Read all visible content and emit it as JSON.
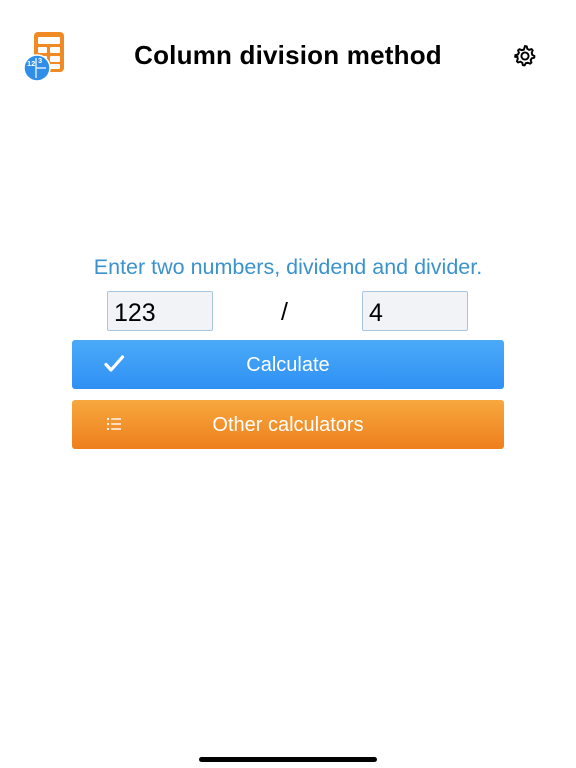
{
  "header": {
    "title": "Column division method",
    "logo_icon": "calculator-logo-icon",
    "logo_digits": "123",
    "settings_icon": "gear-icon"
  },
  "form": {
    "instruction": "Enter two numbers, dividend and divider.",
    "dividend_value": "123",
    "divider_value": "4",
    "operator": "/"
  },
  "buttons": {
    "calculate_label": "Calculate",
    "calculate_icon": "checkmark-icon",
    "other_label": "Other calculators",
    "other_icon": "list-icon"
  },
  "colors": {
    "instruction_text": "#3a93cc",
    "calculate_button": "#3a9cf6",
    "other_button": "#f39530",
    "logo_orange": "#f08a24",
    "logo_blue": "#2f8fe8"
  }
}
